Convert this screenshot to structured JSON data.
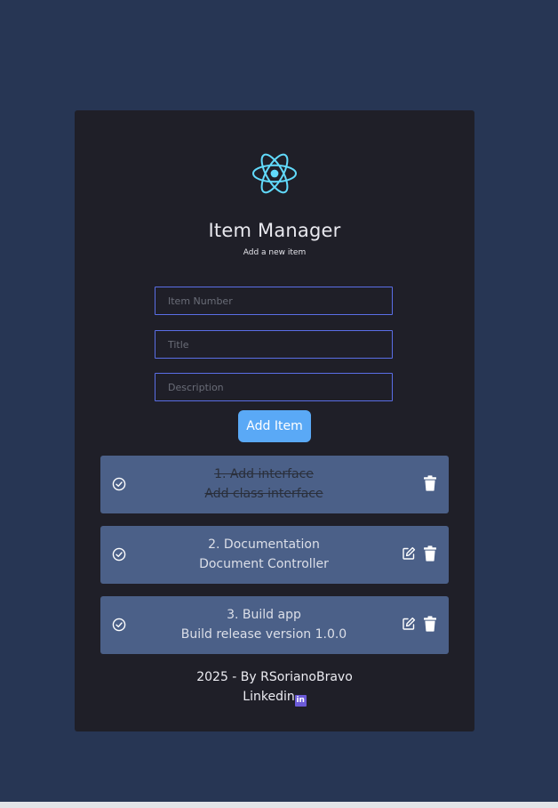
{
  "app": {
    "title": "Item Manager",
    "subtitle": "Add a new item",
    "logo_icon": "react-logo-icon",
    "accent_color": "#61dafb"
  },
  "form": {
    "item_number_placeholder": "Item Number",
    "title_placeholder": "Title",
    "description_placeholder": "Description",
    "add_button_label": "Add Item",
    "button_color": "#5aa9f6"
  },
  "items": [
    {
      "line1": "1. Add interface",
      "line2": "Add class interface",
      "completed": true,
      "editable": false
    },
    {
      "line1": "2. Documentation",
      "line2": "Document Controller",
      "completed": false,
      "editable": true
    },
    {
      "line1": "3. Build app",
      "line2": "Build release version 1.0.0",
      "completed": false,
      "editable": true
    }
  ],
  "footer": {
    "credit": "2025 - By RSorianoBravo",
    "link_label": "Linkedin",
    "link_icon_text": "in",
    "link_icon": "linkedin-icon"
  }
}
